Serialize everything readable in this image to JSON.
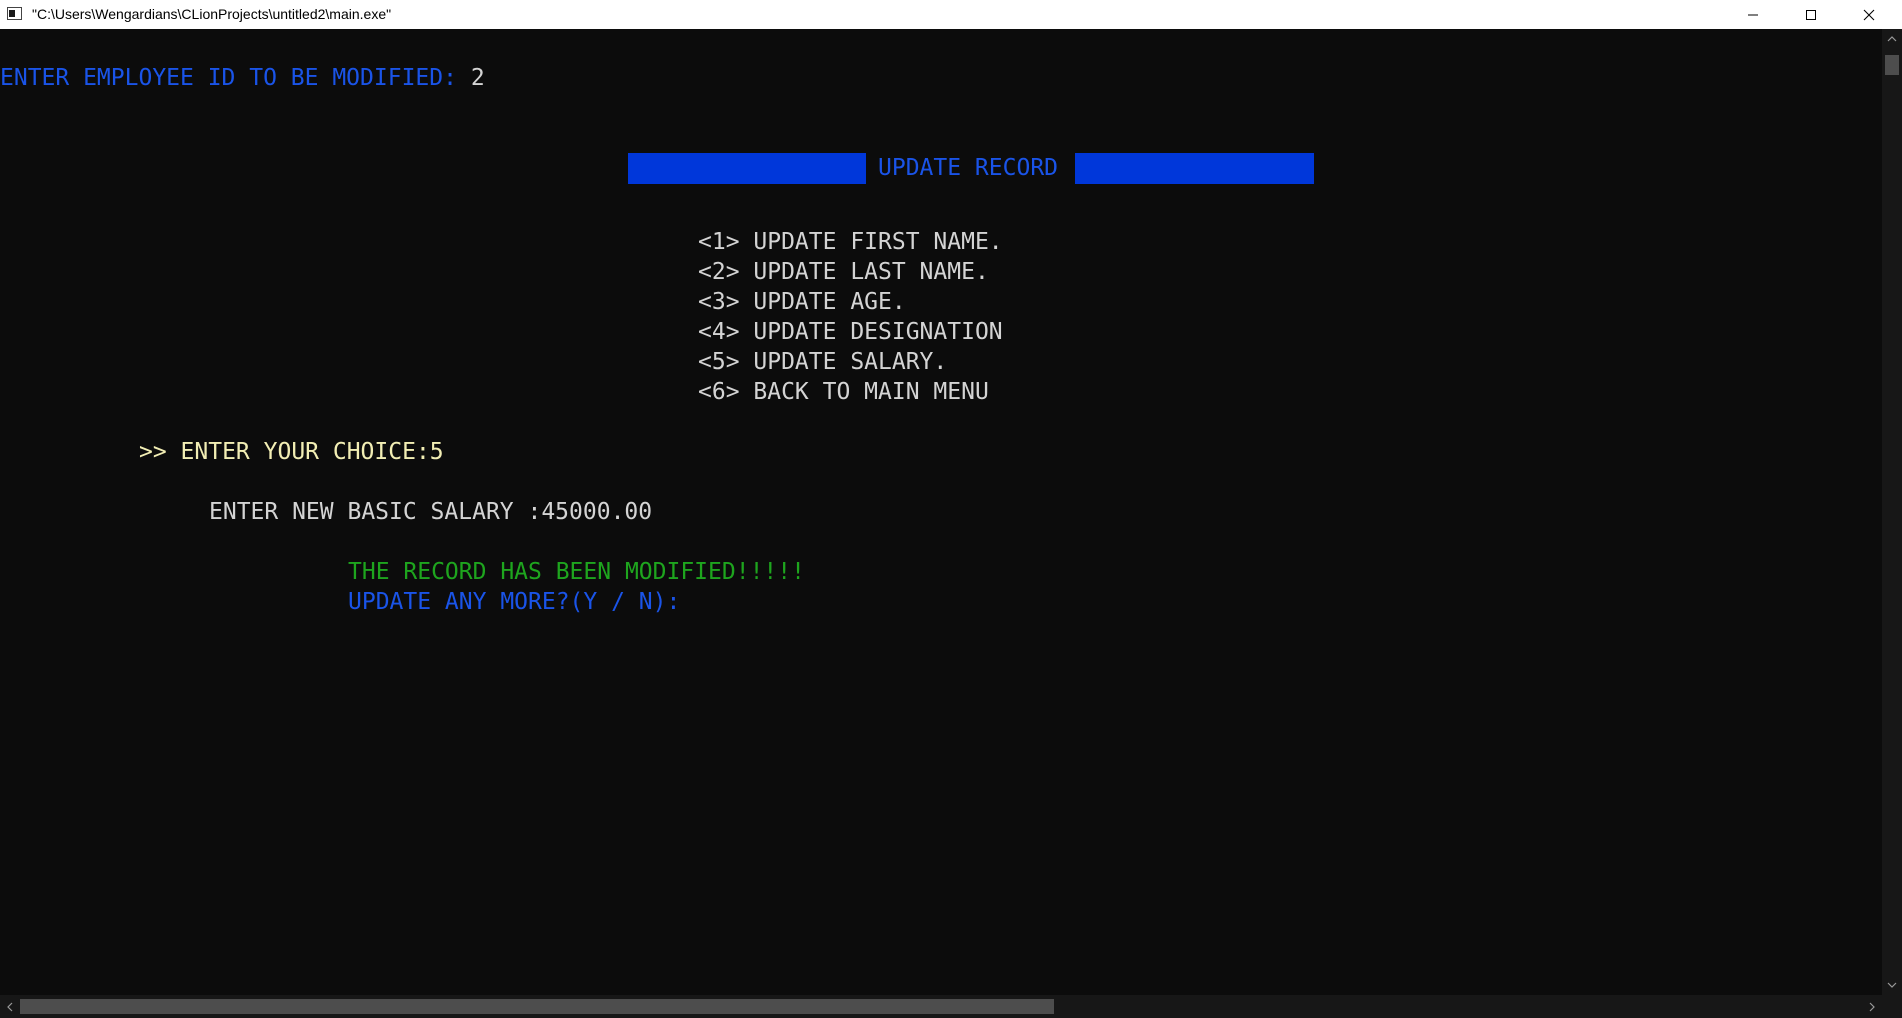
{
  "window": {
    "title": "\"C:\\Users\\Wengardians\\CLionProjects\\untitled2\\main.exe\"",
    "icons": {
      "app": "console-app-icon",
      "minimize": "minimize-icon",
      "maximize": "maximize-icon",
      "close": "close-icon"
    }
  },
  "console": {
    "prompt_id_label": "ENTER EMPLOYEE ID TO BE MODIFIED: ",
    "prompt_id_value": "2",
    "banner_title": "UPDATE RECORD",
    "menu": [
      "<1> UPDATE FIRST NAME.",
      "<2> UPDATE LAST NAME.",
      "<3> UPDATE AGE.",
      "<4> UPDATE DESIGNATION",
      "<5> UPDATE SALARY.",
      "<6> BACK TO MAIN MENU"
    ],
    "choice_line": ">> ENTER YOUR CHOICE:5",
    "salary_line": "ENTER NEW BASIC SALARY :45000.00",
    "success_message": "THE RECORD HAS BEEN MODIFIED!!!!!",
    "update_more_prompt": "UPDATE ANY MORE?(Y / N):"
  },
  "colors": {
    "background": "#0c0c0c",
    "blue_text": "#1a54e8",
    "banner_blue": "#0037da",
    "white_text": "#d4d4d4",
    "yellow_text": "#f2eeb4",
    "green_text": "#1ea51e"
  }
}
